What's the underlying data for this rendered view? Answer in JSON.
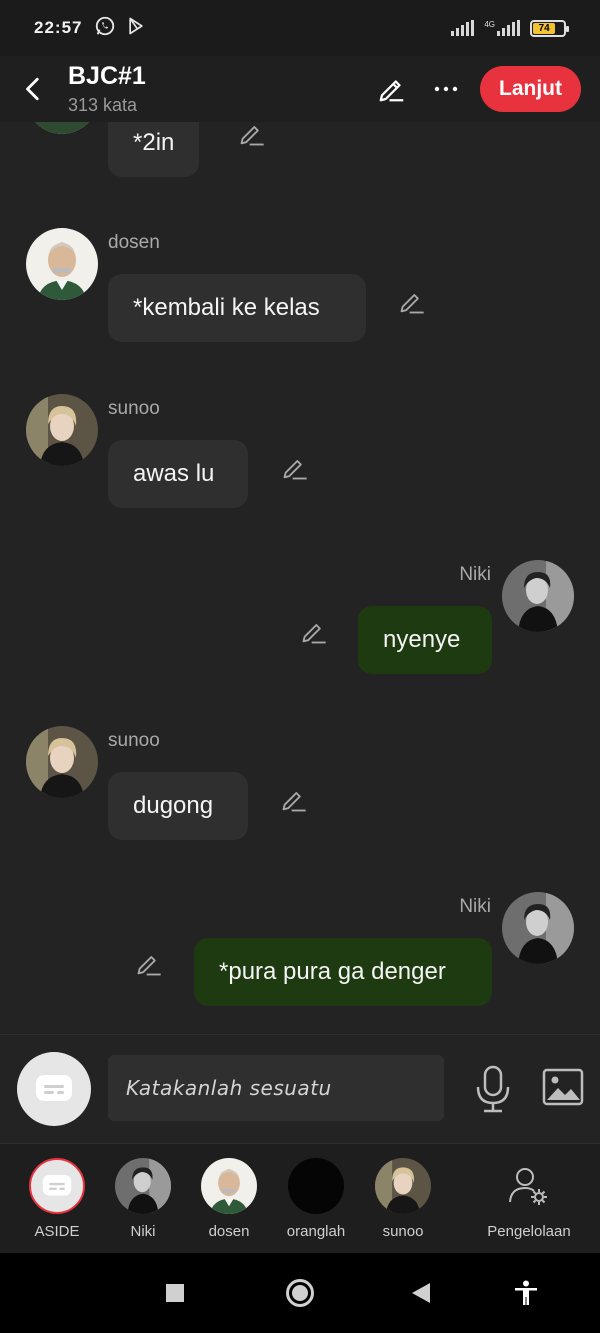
{
  "status_bar": {
    "time": "22:57",
    "network_label": "4G",
    "battery_level": "74",
    "battery_percent": 74
  },
  "header": {
    "title": "BJC#1",
    "word_count": "313 kata",
    "continue_label": "Lanjut"
  },
  "messages": [
    {
      "side": "left",
      "speaker": "",
      "text": "*2in"
    },
    {
      "side": "left",
      "speaker": "dosen",
      "text": "*kembali ke kelas"
    },
    {
      "side": "left",
      "speaker": "sunoo",
      "text": "awas lu"
    },
    {
      "side": "right",
      "speaker": "Niki",
      "text": "nyenye"
    },
    {
      "side": "left",
      "speaker": "sunoo",
      "text": "dugong"
    },
    {
      "side": "right",
      "speaker": "Niki",
      "text": "*pura pura ga denger"
    }
  ],
  "composer": {
    "placeholder": "Katakanlah sesuatu"
  },
  "characters": [
    {
      "label": "ASIDE"
    },
    {
      "label": "Niki"
    },
    {
      "label": "dosen"
    },
    {
      "label": "oranglah"
    },
    {
      "label": "sunoo"
    },
    {
      "label": "Pengelolaan"
    }
  ],
  "colors": {
    "accent": "#e8333f",
    "self_bubble": "#1e3a10",
    "other_bubble": "#2f2f2f",
    "background": "#232323"
  }
}
